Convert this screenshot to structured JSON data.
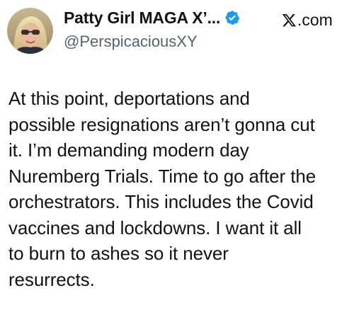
{
  "author": {
    "name": "Patty Girl MAGA X’...",
    "handle": "@PerspicaciousXY",
    "avatar_icon": "profile-photo",
    "verified_icon": "verified-badge-icon",
    "verified_color": "#1d9bf0"
  },
  "source": {
    "label": ".com",
    "icon": "x-logo-icon"
  },
  "tweet": {
    "text": "At this point, deportations and\npossible resignations aren’t gonna cut\nit. I’m demanding modern day\nNuremberg Trials. Time to go after the\norchestrators. This includes the Covid\nvaccines and lockdowns. I want it all\nto burn to ashes so it never\nresurrects."
  }
}
